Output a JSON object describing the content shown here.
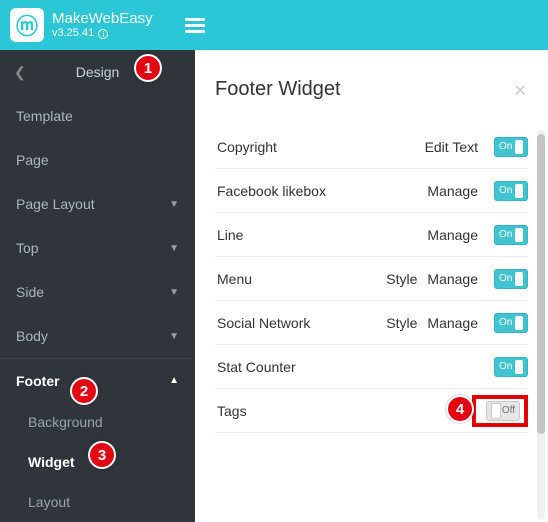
{
  "topbar": {
    "brand": "MakeWebEasy",
    "version": "v3.25.41"
  },
  "sidebar": {
    "breadcrumb": "Design",
    "items": [
      {
        "label": "Template",
        "expandable": false
      },
      {
        "label": "Page",
        "expandable": false
      },
      {
        "label": "Page Layout",
        "expandable": true
      },
      {
        "label": "Top",
        "expandable": true
      },
      {
        "label": "Side",
        "expandable": true
      },
      {
        "label": "Body",
        "expandable": true
      },
      {
        "label": "Footer",
        "expandable": true,
        "expanded": true,
        "children": [
          {
            "label": "Background"
          },
          {
            "label": "Widget",
            "active": true
          },
          {
            "label": "Layout"
          }
        ]
      }
    ]
  },
  "panel": {
    "title": "Footer Widget",
    "rows": [
      {
        "label": "Copyright",
        "actions": [
          "Edit Text"
        ],
        "toggle": "On"
      },
      {
        "label": "Facebook likebox",
        "actions": [
          "Manage"
        ],
        "toggle": "On"
      },
      {
        "label": "Line",
        "actions": [
          "Manage"
        ],
        "toggle": "On"
      },
      {
        "label": "Menu",
        "actions": [
          "Style",
          "Manage"
        ],
        "toggle": "On"
      },
      {
        "label": "Social Network",
        "actions": [
          "Style",
          "Manage"
        ],
        "toggle": "On"
      },
      {
        "label": "Stat Counter",
        "actions": [],
        "toggle": "On"
      },
      {
        "label": "Tags",
        "actions": [],
        "toggle": "Off",
        "highlight": true
      }
    ]
  },
  "callouts": {
    "c1": "1",
    "c2": "2",
    "c3": "3",
    "c4": "4"
  }
}
